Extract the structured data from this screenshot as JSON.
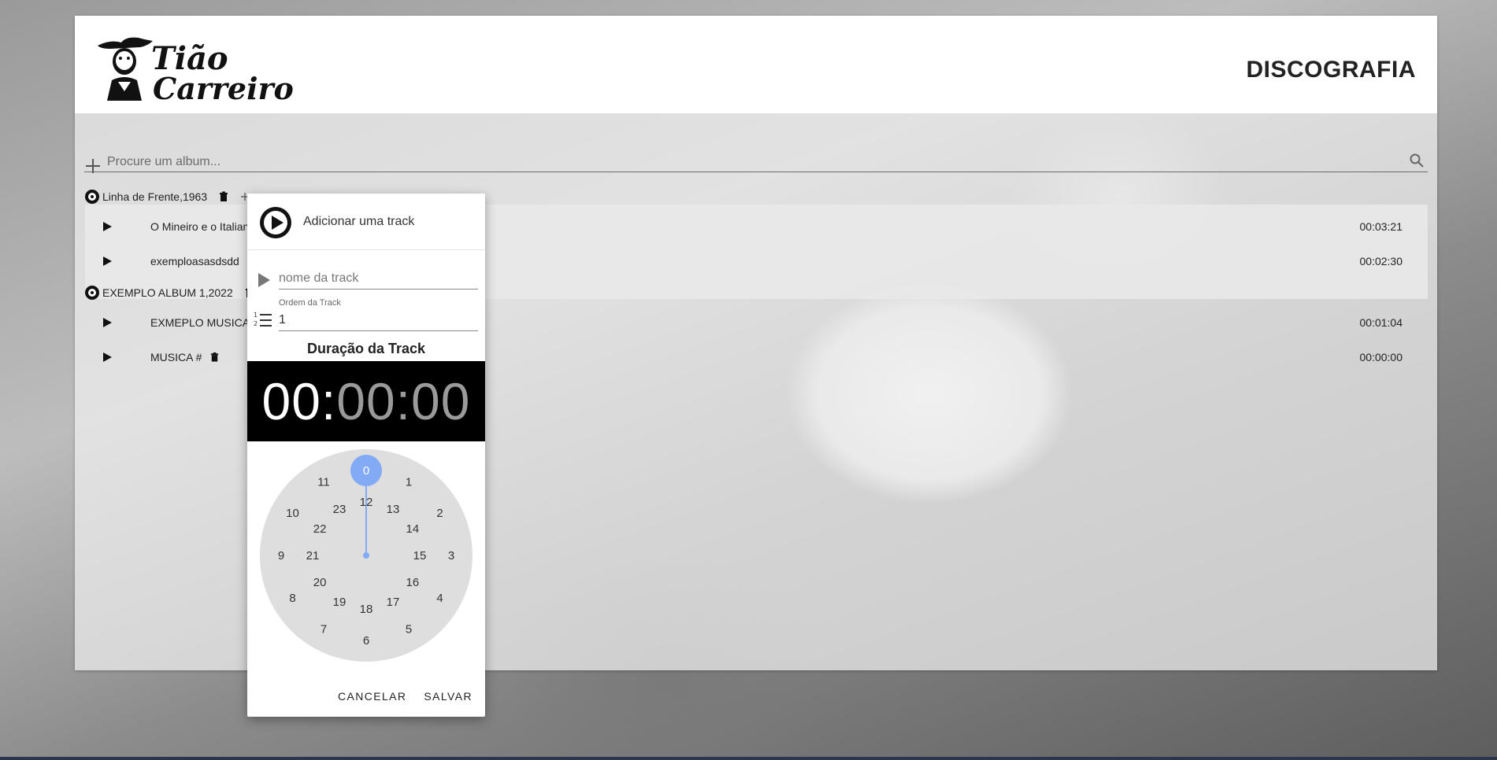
{
  "header": {
    "title": "DISCOGRAFIA",
    "logo_text": "Tião Carreiro"
  },
  "search": {
    "placeholder": "Procure um album..."
  },
  "albums": [
    {
      "title": "Linha de Frente,1963",
      "tracks": [
        {
          "name": "O Mineiro e o Italiano",
          "duration": "00:03:21"
        },
        {
          "name": "exemploasasdsdd",
          "duration": "00:02:30"
        }
      ]
    },
    {
      "title": "EXEMPLO ALBUM 1,2022",
      "tracks": [
        {
          "name": "EXMEPLO MUSICA",
          "duration": "00:01:04"
        },
        {
          "name": "MUSICA #",
          "duration": "00:00:00"
        }
      ]
    }
  ],
  "dialog": {
    "title": "Adicionar uma track",
    "track_name_placeholder": "nome da track",
    "order_label": "Ordem da Track",
    "order_value": "1",
    "duration_label": "Duração da Track",
    "time_hours": "00",
    "time_minutes": "00",
    "time_seconds": "00",
    "selected_hour": "0",
    "clock_outer": [
      "1",
      "2",
      "3",
      "4",
      "5",
      "6",
      "7",
      "8",
      "9",
      "10",
      "11"
    ],
    "clock_inner": [
      "12",
      "13",
      "14",
      "15",
      "16",
      "17",
      "18",
      "19",
      "20",
      "21",
      "22",
      "23"
    ],
    "cancel_label": "CANCELAR",
    "save_label": "SALVAR"
  },
  "colors": {
    "accent": "#82aaf5",
    "dark": "#000000"
  }
}
